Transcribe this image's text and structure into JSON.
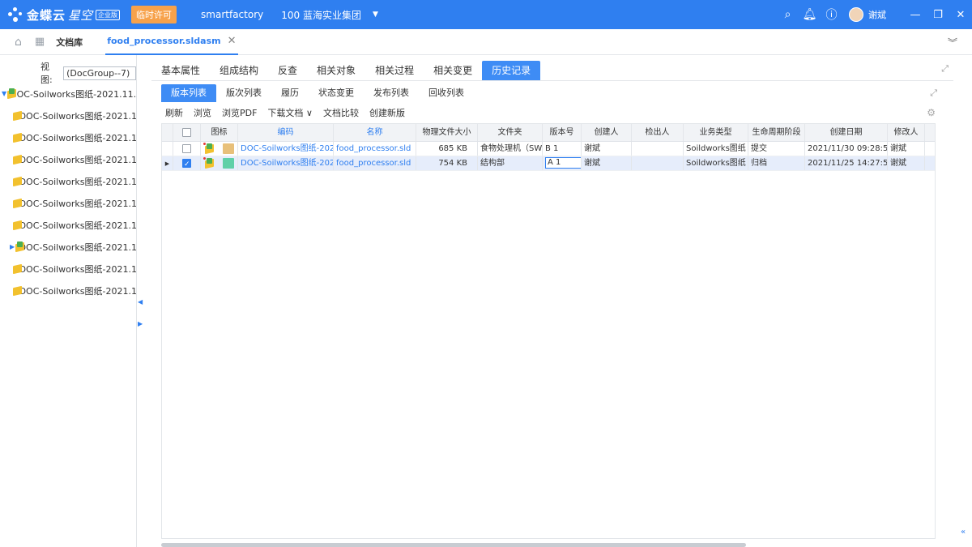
{
  "app": {
    "brand": "金蝶云",
    "brand_sub": "星空",
    "edition": "企业版",
    "license_badge": "临时许可",
    "tenant": "smartfactory",
    "org": "100 蓝海实业集团",
    "user": "谢斌"
  },
  "tabs": {
    "doclib": "文档库",
    "file": "food_processor.sldasm"
  },
  "left": {
    "view_label": "视图:",
    "view_value": "(DocGroup--7)",
    "tree": [
      {
        "label": "DOC-Soilworks图纸-2021.11.2",
        "root": true,
        "expanded": true
      },
      {
        "label": "DOC-Soilworks图纸-2021.1"
      },
      {
        "label": "DOC-Soilworks图纸-2021.1"
      },
      {
        "label": "DOC-Soilworks图纸-2021.1"
      },
      {
        "label": "DOC-Soilworks图纸-2021.1"
      },
      {
        "label": "DOC-Soilworks图纸-2021.1"
      },
      {
        "label": "DOC-Soilworks图纸-2021.1"
      },
      {
        "label": "DOC-Soilworks图纸-2021.1",
        "collapsed": true
      },
      {
        "label": "DOC-Soilworks图纸-2021.1"
      },
      {
        "label": "DOC-Soilworks图纸-2021.1"
      }
    ]
  },
  "main": {
    "tabs": [
      "基本属性",
      "组成结构",
      "反查",
      "相关对象",
      "相关过程",
      "相关变更",
      "历史记录"
    ],
    "active_tab": "历史记录",
    "subtabs": [
      "版本列表",
      "版次列表",
      "履历",
      "状态变更",
      "发布列表",
      "回收列表"
    ],
    "active_subtab": "版本列表",
    "toolbar": [
      "刷新",
      "浏览",
      "浏览PDF",
      "下载文档",
      "文档比较",
      "创建新版"
    ],
    "columns": [
      "图标",
      "编码",
      "名称",
      "物理文件大小",
      "文件夹",
      "版本号",
      "创建人",
      "检出人",
      "业务类型",
      "生命周期阶段",
      "创建日期",
      "修改人"
    ],
    "rows": [
      {
        "code": "DOC-Soilworks图纸-202",
        "name": "food_processor.sld",
        "size": "685 KB",
        "folder": "食物处理机（SW)",
        "version": "B 1",
        "creator": "谢斌",
        "checkout": "",
        "biz": "Soildworks图纸",
        "stage": "提交",
        "date": "2021/11/30 09:28:59",
        "modifier": "谢斌",
        "checked": false,
        "filecolor": "#e8c07a"
      },
      {
        "code": "DOC-Soilworks图纸-202",
        "name": "food_processor.sld",
        "size": "754 KB",
        "folder": "结构部",
        "version": "A 1",
        "creator": "谢斌",
        "checkout": "",
        "biz": "Soildworks图纸",
        "stage": "归档",
        "date": "2021/11/25 14:27:52",
        "modifier": "谢斌",
        "checked": true,
        "filecolor": "#5fd0a8",
        "selected": true,
        "editing": true
      }
    ]
  },
  "watermark": "临时许可",
  "colors": {
    "primary": "#2f7ff0",
    "license": "#f7a24b"
  }
}
